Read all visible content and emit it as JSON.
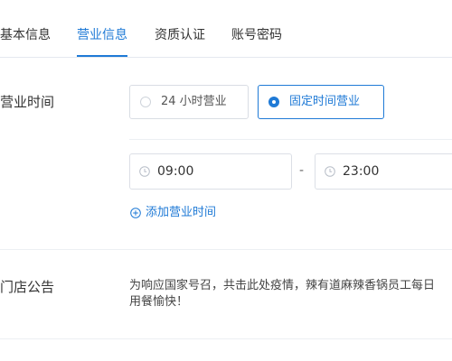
{
  "tabs": [
    {
      "label": "基本信息",
      "active": false
    },
    {
      "label": "营业信息",
      "active": true
    },
    {
      "label": "资质认证",
      "active": false
    },
    {
      "label": "账号密码",
      "active": false
    }
  ],
  "business_hours": {
    "label": "营业时间",
    "options": [
      {
        "label": "24 小时营业",
        "selected": false
      },
      {
        "label": "固定时间营业",
        "selected": true
      }
    ],
    "start_time": "09:00",
    "separator": "-",
    "end_time": "23:00",
    "add_link": "添加营业时间"
  },
  "store_notice": {
    "label": "门店公告",
    "line1": "为响应国家号召，共击此处疫情，辣有道麻辣香锅员工每日",
    "line2": "用餐愉快！"
  },
  "colors": {
    "accent": "#1f7ad6",
    "border": "#d9dde4",
    "divider": "#eceff3",
    "text": "#333333"
  },
  "icons": {
    "time": "clock-icon",
    "add": "plus-circle-icon"
  }
}
